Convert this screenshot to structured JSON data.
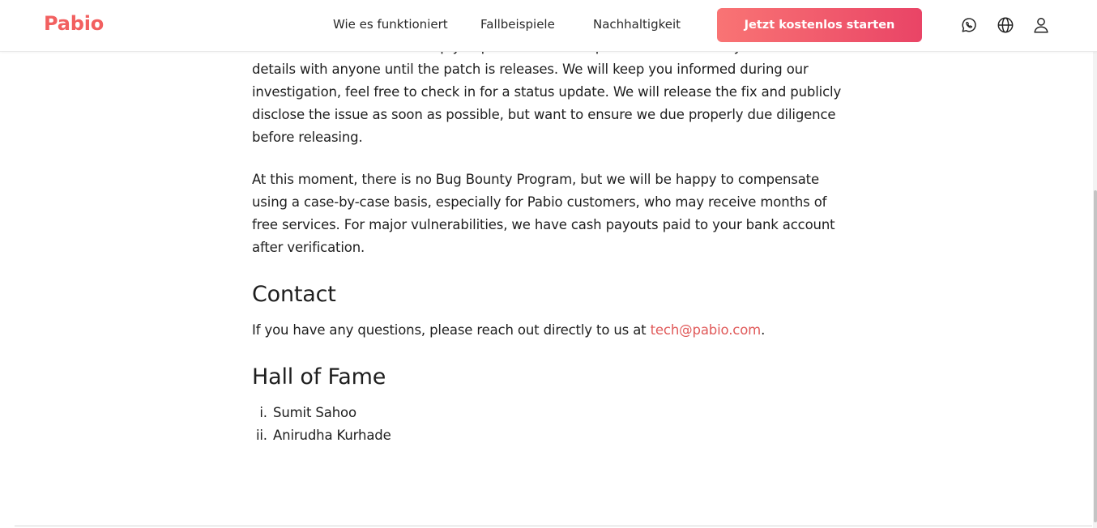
{
  "brand": {
    "logo_text": "Pabio",
    "accent_color": "#f26060"
  },
  "nav": {
    "links": [
      {
        "label": "Wie es funktioniert"
      },
      {
        "label": "Fallbeispiele"
      },
      {
        "label": "Nachhaltigkeit"
      }
    ],
    "cta_label": "Jetzt kostenlos starten",
    "icons": [
      "whatsapp-icon",
      "globe-icon",
      "user-icon"
    ]
  },
  "article": {
    "partial_line": "We'll do it ourselves and keep you posted when the patch is live. We ask you to not share",
    "paragraph_1": "details with anyone until the patch is releases. We will keep you informed during our investigation, feel free to check in for a status update. We will release the fix and publicly disclose the issue as soon as possible, but want to ensure we due properly due diligence before releasing.",
    "paragraph_2": "At this moment, there is no Bug Bounty Program, but we will be happy to compensate using a case-by-case basis, especially for Pabio customers, who may receive months of free services. For major vulnerabilities, we have cash payouts paid to your bank account after verification.",
    "contact_heading": "Contact",
    "contact_text": "If you have any questions, please reach out directly to us at ",
    "contact_email": "tech@pabio.com",
    "contact_end": ".",
    "hall_heading": "Hall of Fame",
    "hall_of_fame": [
      "Sumit Sahoo",
      "Anirudha Kurhade"
    ]
  }
}
